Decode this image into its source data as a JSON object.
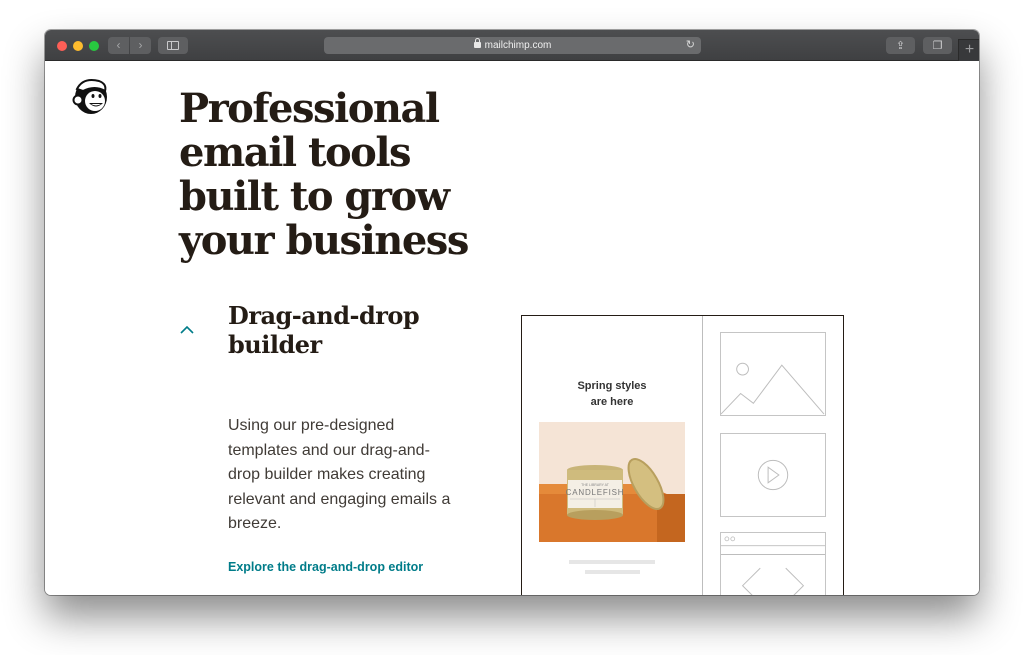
{
  "browser": {
    "url": "mailchimp.com",
    "icons": {
      "back": "chevron-left-icon",
      "forward": "chevron-right-icon",
      "sidebar": "sidebar-icon",
      "lock": "lock-icon",
      "reload": "reload-icon",
      "share": "share-icon",
      "tabs": "tabs-icon",
      "new_tab": "plus-icon"
    },
    "glyphs": {
      "back": "‹",
      "forward": "›",
      "reload": "↻",
      "share": "⇪",
      "tabs": "❐",
      "new_tab": "+"
    }
  },
  "page": {
    "brand": "Mailchimp",
    "hero_title": "Professional email tools built to grow your business",
    "accordion": {
      "title": "Drag-and-drop builder",
      "expanded": true,
      "body": "Using our pre-designed templates and our drag-and-drop builder makes creating relevant and engaging emails a breeze.",
      "link": "Explore the drag-and-drop editor"
    },
    "mockup": {
      "email_heading_line1": "Spring styles",
      "email_heading_line2": "are here",
      "product_label_top": "THE LIBRARY AT",
      "product_label_brand": "CANDLEFISH",
      "blocks": [
        "image-block",
        "video-block",
        "code-block"
      ]
    }
  },
  "colors": {
    "accent": "#007c89",
    "text_dark": "#241c15",
    "chrome": "#3f4042"
  }
}
